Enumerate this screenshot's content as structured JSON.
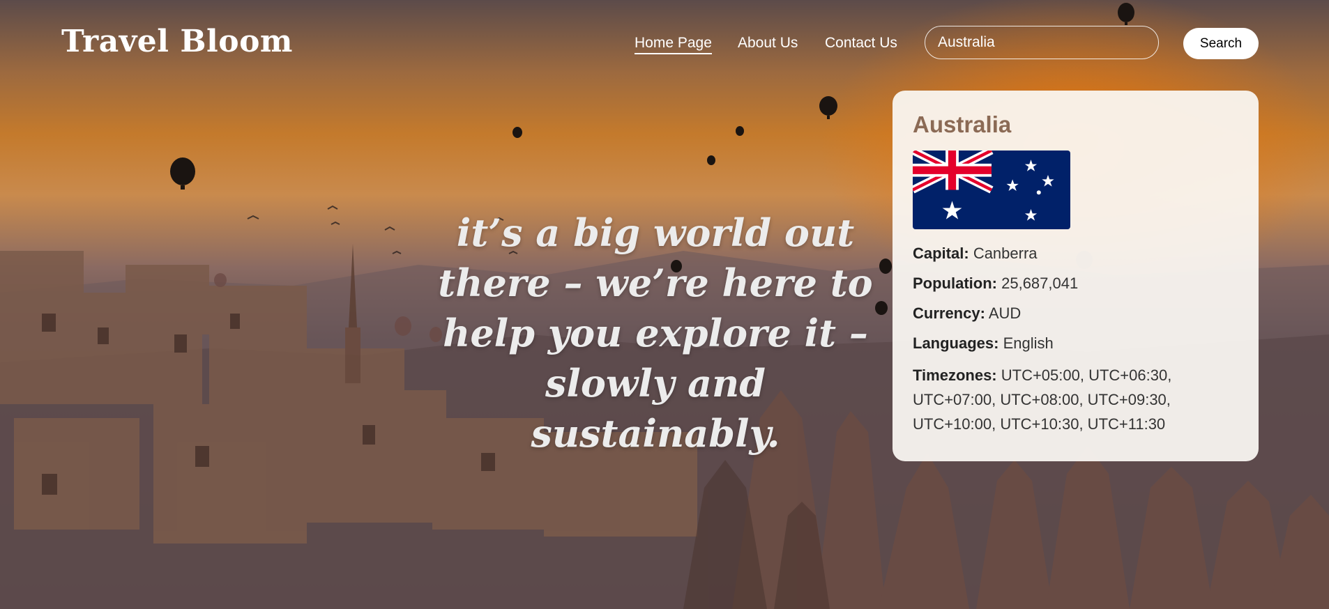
{
  "header": {
    "logo": "Travel Bloom",
    "nav": [
      "Home Page",
      "About Us",
      "Contact Us"
    ],
    "active_nav": "Home Page",
    "search": {
      "value": "Australia",
      "button_label": "Search"
    }
  },
  "hero": {
    "tagline": "it’s a big world out there – we’re here to help you explore it – slowly and sustainably."
  },
  "result_card": {
    "country": "Australia",
    "flag": "australia-flag",
    "capital_label": "Capital:",
    "capital": "Canberra",
    "population_label": "Population:",
    "population": "25,687,041",
    "currency_label": "Currency:",
    "currency": "AUD",
    "languages_label": "Languages:",
    "languages": "English",
    "timezones_label": "Timezones:",
    "timezones": "UTC+05:00, UTC+06:30, UTC+07:00, UTC+08:00, UTC+09:30, UTC+10:00, UTC+10:30, UTC+11:30"
  },
  "colors": {
    "card_title": "#8b6a55",
    "flag_blue": "#012169",
    "flag_red": "#E4002B"
  }
}
